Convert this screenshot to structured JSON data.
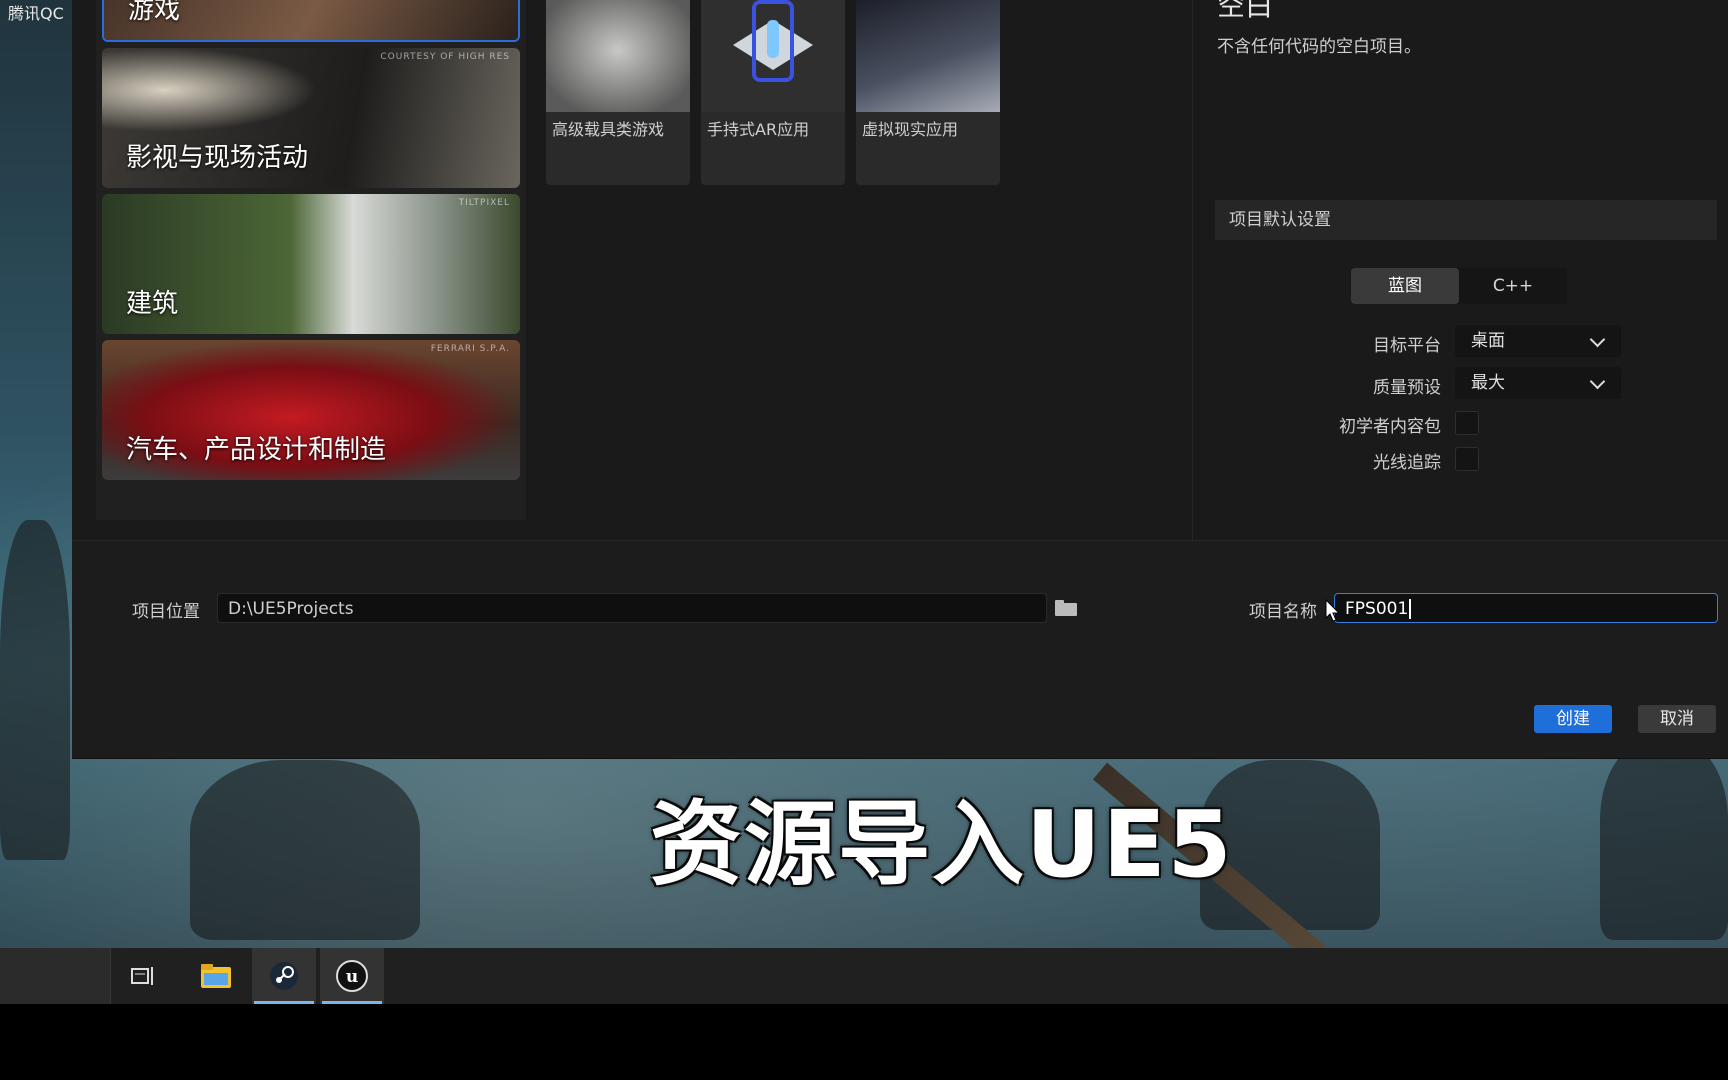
{
  "overlay": {
    "top_left_text": "腾讯QC",
    "caption": "资源导入UE5"
  },
  "categories": [
    {
      "label": "游戏",
      "credit": "",
      "selected": true
    },
    {
      "label": "影视与现场活动",
      "credit": "COURTESY OF HIGH RES",
      "selected": false
    },
    {
      "label": "建筑",
      "credit": "TILTPIXEL",
      "selected": false
    },
    {
      "label": "汽车、产品设计和制造",
      "credit": "FERRARI S.P.A.",
      "selected": false
    }
  ],
  "templates": [
    {
      "label": "高级载具类游戏"
    },
    {
      "label": "手持式AR应用"
    },
    {
      "label": "虚拟现实应用"
    }
  ],
  "details": {
    "title": "空白",
    "description": "不含任何代码的空白项目。"
  },
  "defaults": {
    "header": "项目默认设置",
    "mode_options": [
      "蓝图",
      "C++"
    ],
    "mode_selected": "蓝图",
    "target_platform_label": "目标平台",
    "target_platform_value": "桌面",
    "quality_label": "质量预设",
    "quality_value": "最大",
    "starter_content_label": "初学者内容包",
    "starter_content_checked": false,
    "raytracing_label": "光线追踪",
    "raytracing_checked": false
  },
  "project": {
    "location_label": "项目位置",
    "location_value": "D:\\UE5Projects",
    "name_label": "项目名称",
    "name_value": "FPS001"
  },
  "buttons": {
    "create": "创建",
    "cancel": "取消"
  },
  "colors": {
    "accent": "#1e6fd9",
    "focus": "#3a7be0"
  },
  "taskbar": {
    "items": [
      "task-view-icon",
      "file-explorer-icon",
      "steam-icon",
      "unreal-engine-icon"
    ]
  }
}
